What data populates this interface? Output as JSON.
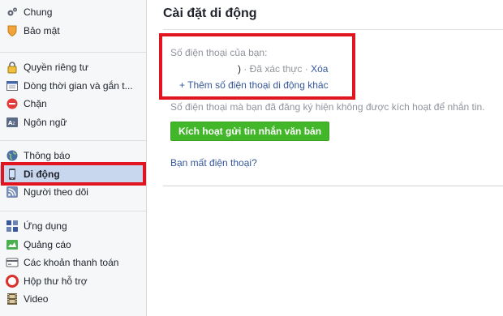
{
  "sidebar": {
    "groups": [
      [
        {
          "label": "Chung",
          "icon": "gears-icon"
        },
        {
          "label": "Bảo mật",
          "icon": "shield-icon"
        }
      ],
      [
        {
          "label": "Quyền riêng tư",
          "icon": "padlock-icon"
        },
        {
          "label": "Dòng thời gian và gắn t...",
          "icon": "timeline-icon"
        },
        {
          "label": "Chặn",
          "icon": "block-icon"
        },
        {
          "label": "Ngôn ngữ",
          "icon": "language-icon"
        }
      ],
      [
        {
          "label": "Thông báo",
          "icon": "globe-icon"
        },
        {
          "label": "Di động",
          "icon": "mobile-icon",
          "active": true
        },
        {
          "label": "Người theo dõi",
          "icon": "rss-icon"
        }
      ],
      [
        {
          "label": "Ứng dụng",
          "icon": "apps-icon"
        },
        {
          "label": "Quảng cáo",
          "icon": "ads-icon"
        },
        {
          "label": "Các khoản thanh toán",
          "icon": "credit-card-icon"
        },
        {
          "label": "Hộp thư hỗ trợ",
          "icon": "lifebuoy-icon"
        },
        {
          "label": "Video",
          "icon": "film-icon"
        }
      ]
    ]
  },
  "main": {
    "title": "Cài đặt di động",
    "phone_label": "Số điện thoại của bạn:",
    "phone_number": ")",
    "verified_text": "· Đã xác thực ·",
    "delete_link": "Xóa",
    "add_phone_link": "+ Thêm số điện thoại di động khác",
    "warning": "Số điện thoại mà bạn đã đăng ký hiện không được kích hoạt để nhắn tin.",
    "activate_button": "Kích hoạt gửi tin nhắn văn bản",
    "lost_phone_link": "Bạn mất điện thoại?"
  },
  "colors": {
    "link": "#365899",
    "button_green": "#42b72a",
    "highlight_red": "#e0151f",
    "active_row": "#c9d7ee"
  }
}
